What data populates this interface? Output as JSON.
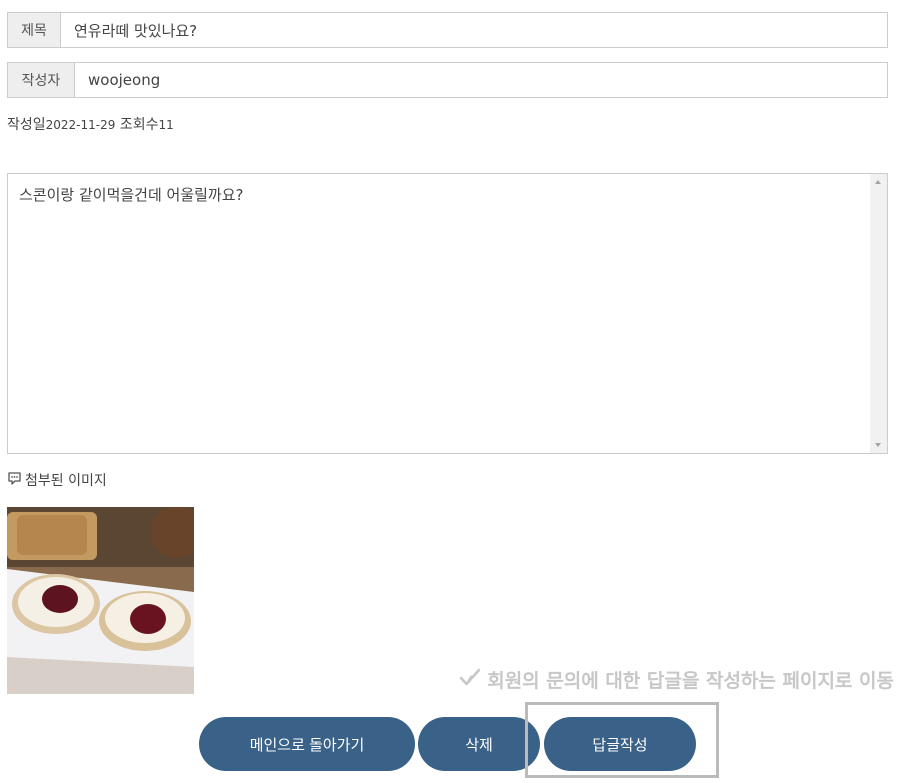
{
  "form": {
    "title_label": "제목",
    "title_value": "연유라떼 맛있나요?",
    "author_label": "작성자",
    "author_value": "woojeong"
  },
  "meta": {
    "date_label": "작성일",
    "date_value": "2022-11-29",
    "views_label": "조회수",
    "views_value": "11"
  },
  "content": {
    "text": "스콘이랑 같이먹을건데 어울릴까요?"
  },
  "attachment": {
    "label": "첨부된 이미지",
    "icon": "comment-icon"
  },
  "hint": {
    "icon": "check-icon",
    "text": "회원의 문의에 대한 답글을 작성하는 페이지로 이동"
  },
  "buttons": {
    "main": "메인으로 돌아가기",
    "delete": "삭제",
    "reply": "답글작성"
  },
  "colors": {
    "button": "#3a6188",
    "hint": "#c7c7c7"
  }
}
